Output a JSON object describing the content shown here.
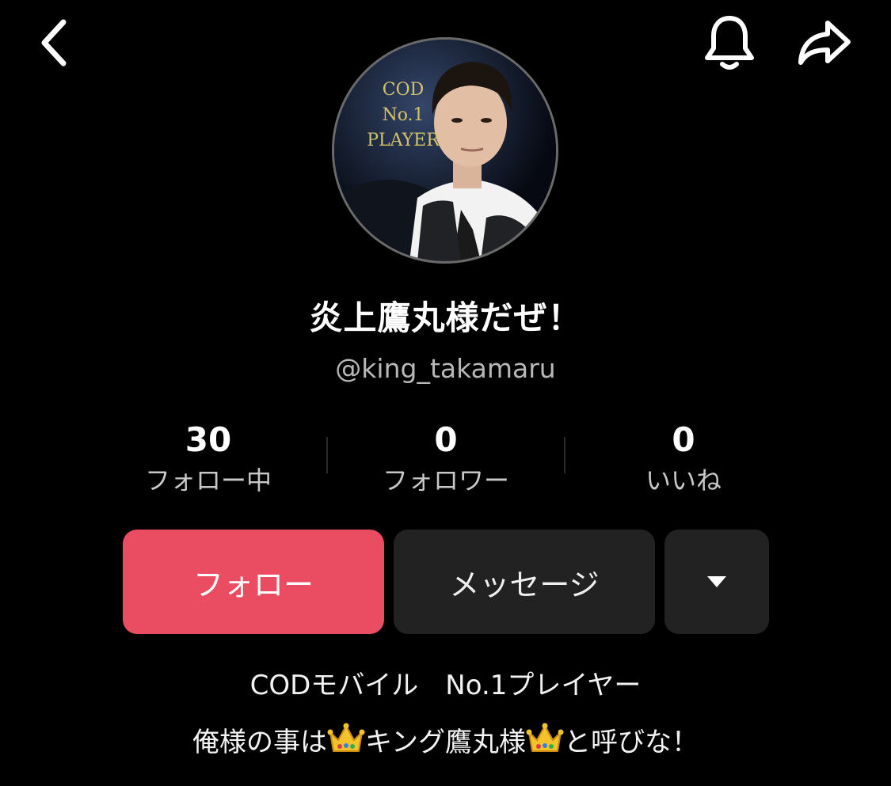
{
  "profile": {
    "display_name": "炎上鷹丸様だぜ！",
    "username": "@king_takamaru",
    "avatar_text": [
      "COD",
      "No.1",
      "PLAYER"
    ]
  },
  "stats": [
    {
      "value": "30",
      "label": "フォロー中"
    },
    {
      "value": "0",
      "label": "フォロワー"
    },
    {
      "value": "0",
      "label": "いいね"
    }
  ],
  "actions": {
    "follow_label": "フォロー",
    "message_label": "メッセージ"
  },
  "bio": {
    "line1": "CODモバイル　No.1プレイヤー",
    "line2_part1": "俺様の事は",
    "line2_part2": "キング鷹丸様",
    "line2_part3": "と呼びな！"
  },
  "icons": {
    "back": "chevron-left-icon",
    "bell": "bell-icon",
    "share": "share-arrow-icon",
    "more": "caret-down-icon",
    "crown": "crown-emoji"
  },
  "colors": {
    "background": "#000000",
    "follow_button": "#ea4d61",
    "secondary_button": "#222222",
    "avatar_text": "#d4c26a"
  }
}
